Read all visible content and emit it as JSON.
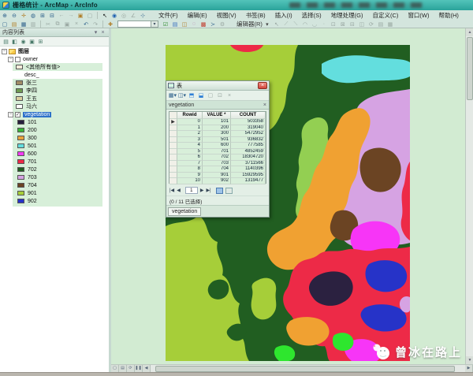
{
  "titlebar": {
    "title": "栅格统计 - ArcMap - ArcInfo"
  },
  "menubar": {
    "items": [
      "文件(F)",
      "编辑(E)",
      "视图(V)",
      "书签(B)",
      "插入(I)",
      "选择(S)",
      "地理处理(G)",
      "自定义(C)",
      "窗口(W)",
      "帮助(H)"
    ]
  },
  "toolbar": {
    "editor_label": "编辑器(R)",
    "editor_arrow": "▾",
    "scale_value": ""
  },
  "toc": {
    "title": "内容列表",
    "root_label": "图层",
    "owner": {
      "label": "owner",
      "items": [
        {
          "label": "<其他所有值>",
          "swatch": "#f4ecda"
        },
        {
          "label": "desc_",
          "swatch": ""
        },
        {
          "label": "张三",
          "swatch": "#a18c66"
        },
        {
          "label": "李四",
          "swatch": "#6f9b52"
        },
        {
          "label": "王五",
          "swatch": "#d9cf9e"
        },
        {
          "label": "马六",
          "swatch": "#ffffff"
        }
      ]
    },
    "vegetation": {
      "label": "vegetation",
      "classes": [
        {
          "value": "101",
          "color": "#26203c"
        },
        {
          "value": "200",
          "color": "#38b438"
        },
        {
          "value": "300",
          "color": "#e8a33c"
        },
        {
          "value": "501",
          "color": "#63dede"
        },
        {
          "value": "600",
          "color": "#f23cf2"
        },
        {
          "value": "701",
          "color": "#ed2a47"
        },
        {
          "value": "702",
          "color": "#215e21"
        },
        {
          "value": "703",
          "color": "#d6a3e3"
        },
        {
          "value": "704",
          "color": "#6b4423"
        },
        {
          "value": "901",
          "color": "#a6ce39"
        },
        {
          "value": "902",
          "color": "#2633c8"
        }
      ]
    }
  },
  "table_window": {
    "title": "表",
    "tab": "vegetation",
    "columns": [
      "Rowid",
      "VALUE *",
      "COUNT"
    ],
    "rows": [
      {
        "rowid": "0",
        "value": "101",
        "count": "503358"
      },
      {
        "rowid": "1",
        "value": "200",
        "count": "319040"
      },
      {
        "rowid": "2",
        "value": "300",
        "count": "5472952"
      },
      {
        "rowid": "3",
        "value": "501",
        "count": "936832"
      },
      {
        "rowid": "4",
        "value": "600",
        "count": "777585"
      },
      {
        "rowid": "5",
        "value": "701",
        "count": "4852459"
      },
      {
        "rowid": "6",
        "value": "702",
        "count": "18304720"
      },
      {
        "rowid": "7",
        "value": "703",
        "count": "3711566"
      },
      {
        "rowid": "8",
        "value": "704",
        "count": "1140396"
      },
      {
        "rowid": "9",
        "value": "901",
        "count": "15929595"
      },
      {
        "rowid": "10",
        "value": "902",
        "count": "1319477"
      }
    ],
    "nav_page": "1",
    "status": "(0 / 11 已选择)",
    "bottom_tab": "vegetation"
  },
  "watermark": {
    "text": "曾冰在路上"
  },
  "colors": {
    "titlebar": "#2aa39a",
    "selection": "#2f72c9",
    "map_background": "#d2ebd2",
    "toc_highlight": "#d7efd9"
  }
}
